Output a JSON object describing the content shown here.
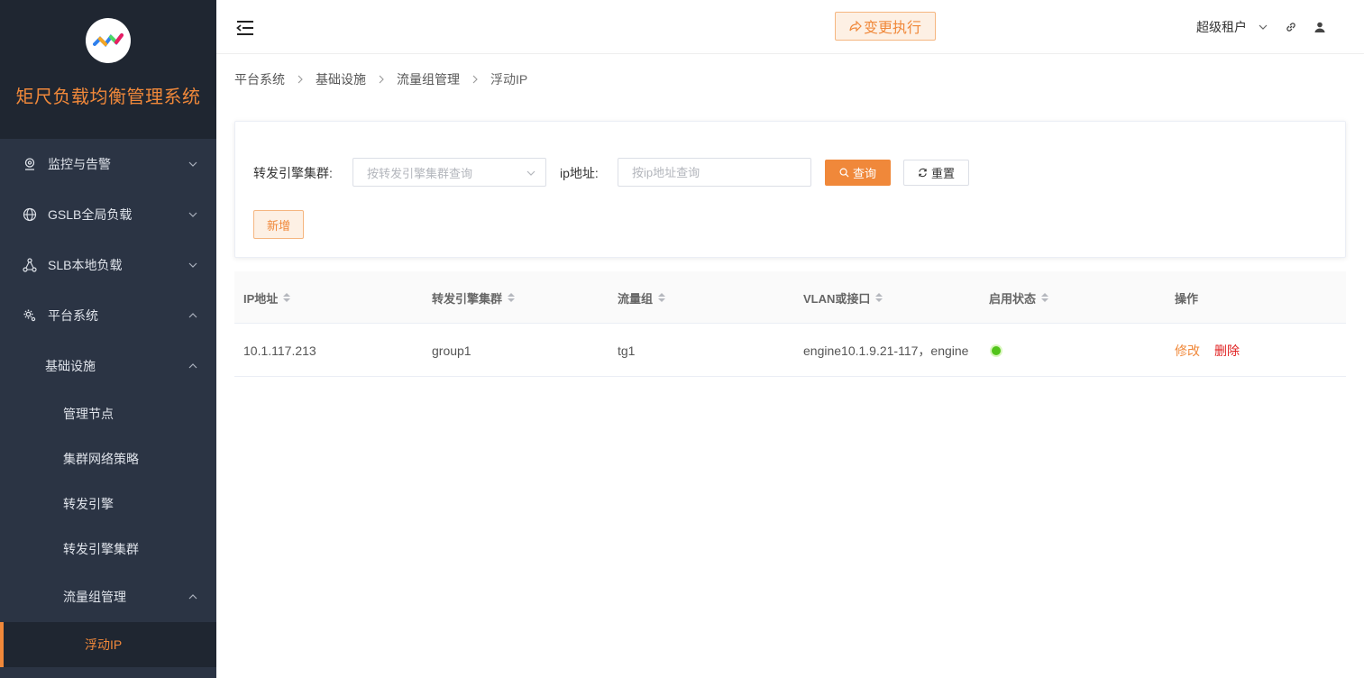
{
  "app": {
    "title": "矩尺负载均衡管理系统"
  },
  "sidebar": {
    "menu": [
      {
        "label": "监控与告警",
        "icon": "location-pin-icon",
        "expanded": false
      },
      {
        "label": "GSLB全局负载",
        "icon": "globe-icon",
        "expanded": false
      },
      {
        "label": "SLB本地负载",
        "icon": "nodes-icon",
        "expanded": false
      },
      {
        "label": "平台系统",
        "icon": "gear-icon",
        "expanded": true
      }
    ],
    "sub": {
      "infra": "基础设施",
      "mgmt_node": "管理节点",
      "cluster_policy": "集群网络策略",
      "engine": "转发引擎",
      "engine_cluster": "转发引擎集群",
      "traffic_group": "流量组管理",
      "floating_ip": "浮动IP"
    }
  },
  "header": {
    "exec_button": "变更执行",
    "user_name": "超级租户",
    "accent": "#f0883a"
  },
  "breadcrumb": [
    "平台系统",
    "基础设施",
    "流量组管理",
    "浮动IP"
  ],
  "search": {
    "cluster_label": "转发引擎集群:",
    "cluster_placeholder": "按转发引擎集群查询",
    "ip_label": "ip地址:",
    "ip_placeholder": "按ip地址查询",
    "query_button": "查询",
    "reset_button": "重置",
    "add_button": "新增"
  },
  "table": {
    "columns": [
      "IP地址",
      "转发引擎集群",
      "流量组",
      "VLAN或接口",
      "启用状态",
      "操作"
    ],
    "rows": [
      {
        "ip": "10.1.117.213",
        "cluster": "group1",
        "traffic_group": "tg1",
        "vlan": "engine10.1.9.21-117，engine",
        "enabled": true,
        "edit": "修改",
        "delete": "删除"
      }
    ]
  }
}
